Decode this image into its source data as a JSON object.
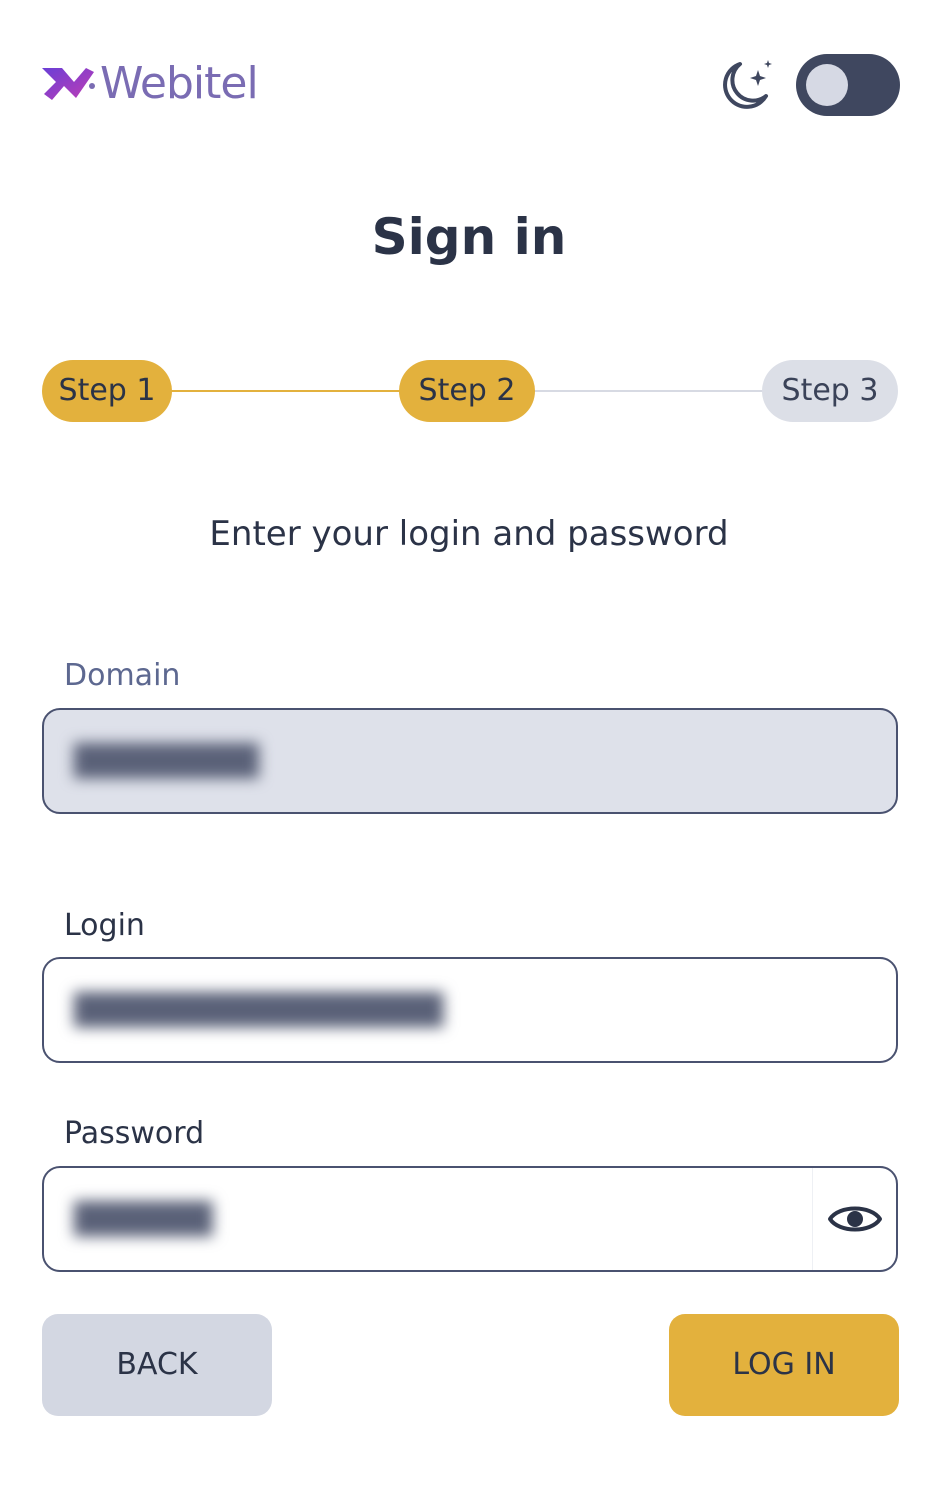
{
  "brand": {
    "name": "Webitel"
  },
  "theme_toggle": {
    "icon": "moon-stars-icon",
    "state": "off"
  },
  "title": "Sign in",
  "steps": [
    {
      "label": "Step 1",
      "state": "done"
    },
    {
      "label": "Step 2",
      "state": "active"
    },
    {
      "label": "Step 3",
      "state": "pending"
    }
  ],
  "subtitle": "Enter your login and password",
  "form": {
    "domain": {
      "label": "Domain"
    },
    "login": {
      "label": "Login"
    },
    "password": {
      "label": "Password",
      "toggle_icon": "eye-icon"
    }
  },
  "buttons": {
    "back": "BACK",
    "login": "LOG IN"
  },
  "colors": {
    "accent": "#e3b13d",
    "brand": "#7a6cb3",
    "text": "#2b3347",
    "muted": "#dcdfe7"
  }
}
